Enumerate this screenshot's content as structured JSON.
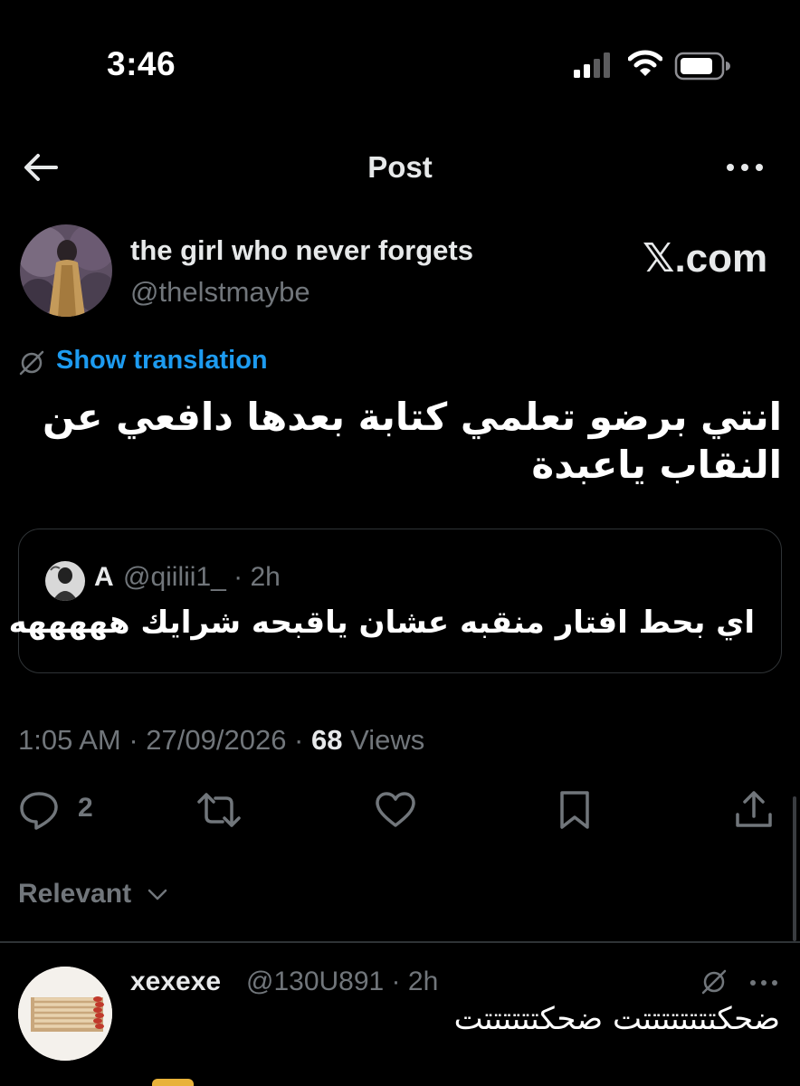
{
  "status_bar": {
    "time": "3:46",
    "signal_icon": "cellular-signal-icon",
    "wifi_icon": "wifi-icon",
    "battery_icon": "battery-icon"
  },
  "nav": {
    "back_icon": "arrow-left-icon",
    "title": "Post",
    "more_icon": "more-horizontal-icon"
  },
  "post": {
    "author_name": "the girl who never forgets",
    "author_handle": "@thelstmaybe",
    "watermark": "𝕏.com",
    "show_translation": "Show translation",
    "translate_icon": "globe-slash-icon",
    "text": "انتي برضو تعلمي كتابة بعدها دافعي عن النقاب ياعبدة",
    "quote": {
      "name": "A",
      "handle_time": "@qiilii1_ · 2h",
      "text": "اي بحط افتار منقبه عشان ياقبحه شرايك هههههه"
    },
    "time_date": "1:05 AM · 27/09/2026 · ",
    "views_count": "68",
    "views_label": " Views"
  },
  "actions": {
    "reply_icon": "reply-icon",
    "reply_count": "2",
    "retweet_icon": "retweet-icon",
    "like_icon": "heart-icon",
    "bookmark_icon": "bookmark-icon",
    "share_icon": "share-icon"
  },
  "sort": {
    "label": "Relevant"
  },
  "reply": {
    "name": "xexexe",
    "handle_time": "@130U891 · 2h",
    "text": "ضحكتتتتتتتتت ضحكتتتتتتت"
  },
  "colors": {
    "background": "#000000",
    "accent": "#1d9bf0",
    "secondary_text": "#71767b",
    "primary_text": "#e7e9ea",
    "border": "#2f3336"
  }
}
